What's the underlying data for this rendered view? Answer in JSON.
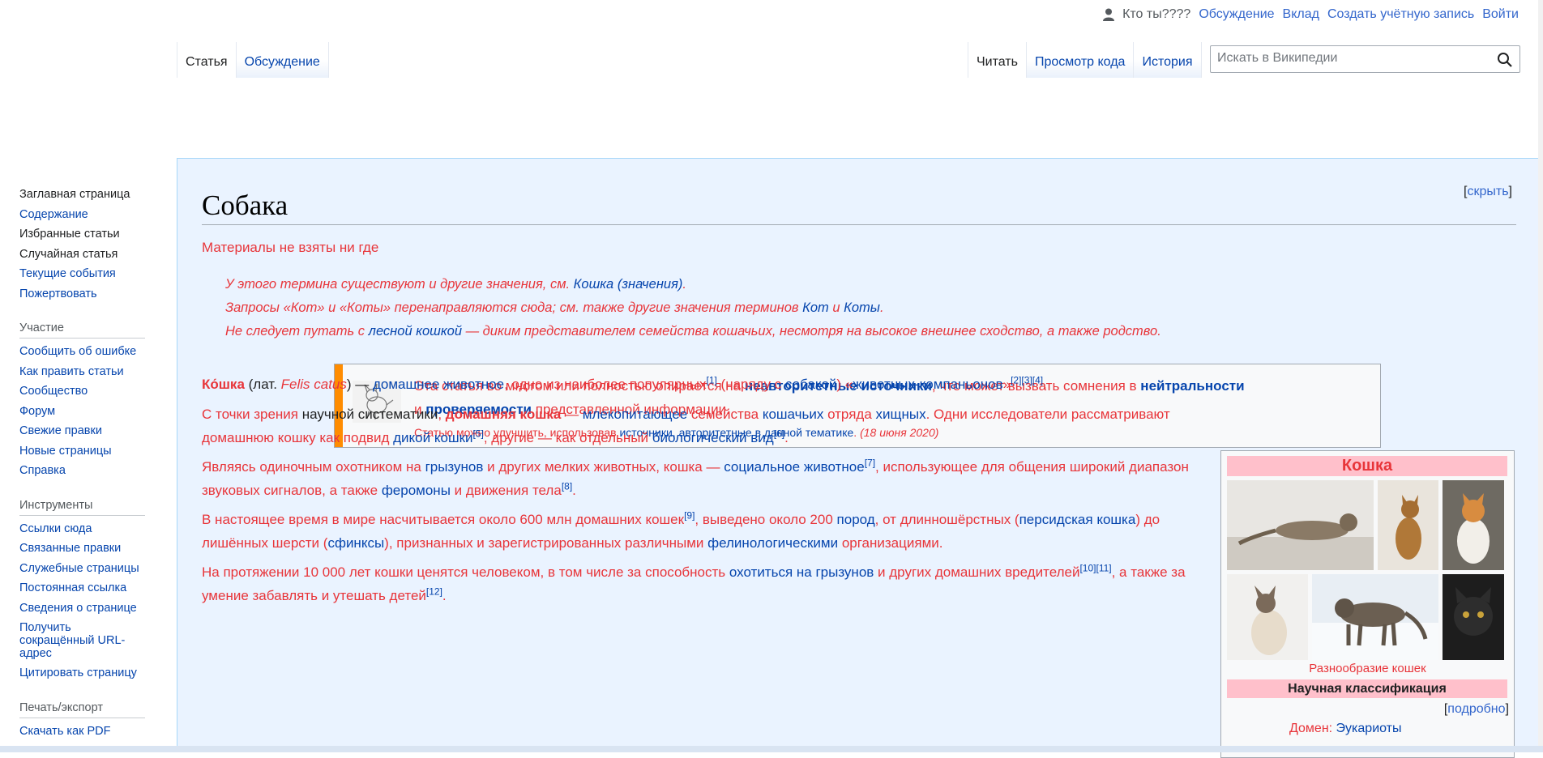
{
  "personal": {
    "user": "Кто ты????",
    "links": [
      "Обсуждение",
      "Вклад",
      "Создать учётную запись",
      "Войти"
    ]
  },
  "tabs": {
    "left": [
      "Статья",
      "Обсуждение"
    ],
    "right": [
      "Читать",
      "Просмотр кода",
      "История"
    ]
  },
  "search": {
    "placeholder": "Искать в Википедии"
  },
  "sidebar": {
    "main": [
      "Заглавная страница",
      "Содержание",
      "Избранные статьи",
      "Случайная статья",
      "Текущие события",
      "Пожертвовать"
    ],
    "participation_heading": "Участие",
    "participation": [
      "Сообщить об ошибке",
      "Как править статьи",
      "Сообщество",
      "Форум",
      "Свежие правки",
      "Новые страницы",
      "Справка"
    ],
    "tools_heading": "Инструменты",
    "tools": [
      "Ссылки сюда",
      "Связанные правки",
      "Служебные страницы",
      "Постоянная ссылка",
      "Сведения о странице",
      "Получить сокращённый URL-адрес",
      "Цитировать страницу"
    ],
    "print_heading": "Печать/экспорт",
    "print": [
      "Скачать как PDF"
    ]
  },
  "article": {
    "title": "Собака",
    "hide": "скрыть",
    "sitesub": "Материалы не взяты ни где",
    "hatnote1": {
      "pre": "У этого термина существуют и другие значения, см. ",
      "link": "Кошка (значения)",
      "post": "."
    },
    "hatnote2": {
      "pre": "Запросы «Кот» и «Коты» перенаправляются сюда; см. также другие значения терминов ",
      "link1": "Кот",
      "mid": " и ",
      "link2": "Коты",
      "post": "."
    },
    "hatnote3": {
      "pre": "Не следует путать с ",
      "link": "лесной кошкой",
      "post": " — диким представителем семейства кошачьих, несмотря на высокое внешнее сходство, а также родство."
    },
    "ambox": {
      "a": "Эта статья во многом или полностью опирается на ",
      "b": "неавторитетные источники",
      "c": ", что может вызвать сомнения в ",
      "d": "нейтральности",
      "e": "и ",
      "f": "проверяемости",
      "g": " представленной информации.",
      "s1": "Статью можно улучшить, использовав ",
      "s2": "источники, авторитетные в данной тематике",
      "s3": ".",
      "date": "(18 июня 2020)"
    },
    "p1": {
      "a": "Ко́шка",
      "b": " (лат. ",
      "c": "Felis catus",
      "d": ") — ",
      "e": "домашнее животное",
      "f": ", одно из наиболее популярных",
      "s1": "[1]",
      "g": " (наряду с ",
      "h": "собакой",
      "i": ") «",
      "j": "животных-компаньонов",
      "k": "»",
      "s2": "[2][3][4]",
      "l": "."
    },
    "p2": {
      "a": "С точки зрения ",
      "b": "научной систематики",
      "c": ", ",
      "d": "домашняя кошка",
      "e": " — ",
      "f": "млекопитающее",
      "g": " ",
      "h": "семейства",
      "i": " ",
      "j": "кошачьих",
      "k": " ",
      "l": "отряда",
      "m": " ",
      "n": "хищных",
      "o": ". Одни исследователи рассматривают домашнюю кошку как подвид ",
      "p": "дикой кошки",
      "s1": "[5]",
      "q": ", другие — как отдельный ",
      "r": "биологический вид",
      "s2": "[6]",
      "t": "."
    },
    "p3": {
      "a": "Являясь одиночным охотником на ",
      "b": "грызунов",
      "c": " и других мелких животных, кошка — ",
      "d": "социальное животное",
      "s1": "[7]",
      "e": ", использующее для общения широкий диапазон звуковых сигналов, а также ",
      "f": "феромоны",
      "g": " и движения тела",
      "s2": "[8]",
      "h": "."
    },
    "p4": {
      "a": "В настоящее время в мире насчитывается около 600 млн домашних кошек",
      "s1": "[9]",
      "b": ", выведено около 200 ",
      "c": "пород",
      "d": ", от длинношёрстных (",
      "e": "персидская кошка",
      "f": ") до лишённых шерсти (",
      "g": "сфинксы",
      "h": "), признанных и зарегистрированных различными ",
      "i": "фелинологическими",
      "j": " организациями."
    },
    "p5": {
      "a": "На протяжении 10 000 лет кошки ценятся человеком, в том числе за способность ",
      "b": "охотиться на грызунов",
      "c": " и других домашних вредителей",
      "s1": "[10][11]",
      "d": ", а также за умение забавлять и утешать детей",
      "s2": "[12]",
      "e": "."
    }
  },
  "infobox": {
    "title": "Кошка",
    "caption": "Разнообразие кошек",
    "sci_heading": "Научная классификация",
    "more": "подробно",
    "domain_label": "Домен:",
    "domain_value": "Эукариоты"
  },
  "colors": {
    "link": "#0645ad",
    "accent": "#e8353a",
    "background": "#eaf3ff",
    "infobox_header": "#ffc0cb",
    "ambox_bar": "#ff8c00"
  }
}
